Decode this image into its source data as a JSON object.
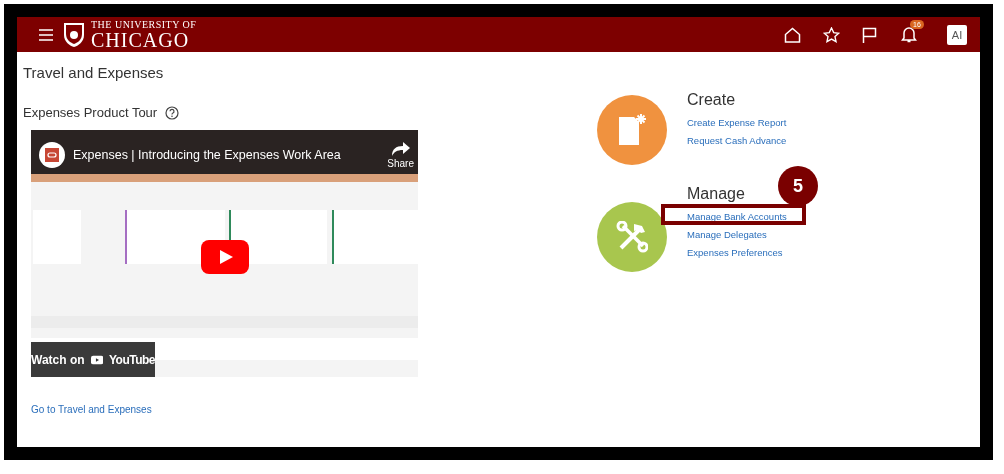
{
  "header": {
    "logo_line_1": "THE UNIVERSITY OF",
    "logo_line_2": "CHICAGO",
    "notification_count": "16",
    "avatar": "AI"
  },
  "page_title": "Travel and Expenses",
  "tour": {
    "heading": "Expenses Product Tour",
    "video": {
      "kind": "picture",
      "title": "Expenses | Introducing the Expenses Work Area",
      "share": "Share",
      "watch_on": "Watch on",
      "platform": "YouTube"
    },
    "link": "Go to Travel and Expenses"
  },
  "sections": [
    {
      "kind": "create",
      "heading": "Create",
      "links": [
        {
          "label": "Create Expense Report",
          "highlighted": false
        },
        {
          "label": "Request Cash Advance",
          "highlighted": false
        }
      ]
    },
    {
      "kind": "manage",
      "heading": "Manage",
      "links": [
        {
          "label": "Manage Bank Accounts",
          "highlighted": true
        },
        {
          "label": "Manage Delegates",
          "highlighted": false
        },
        {
          "label": "Expenses Preferences",
          "highlighted": false
        }
      ]
    }
  ],
  "callout": {
    "number": "5"
  }
}
